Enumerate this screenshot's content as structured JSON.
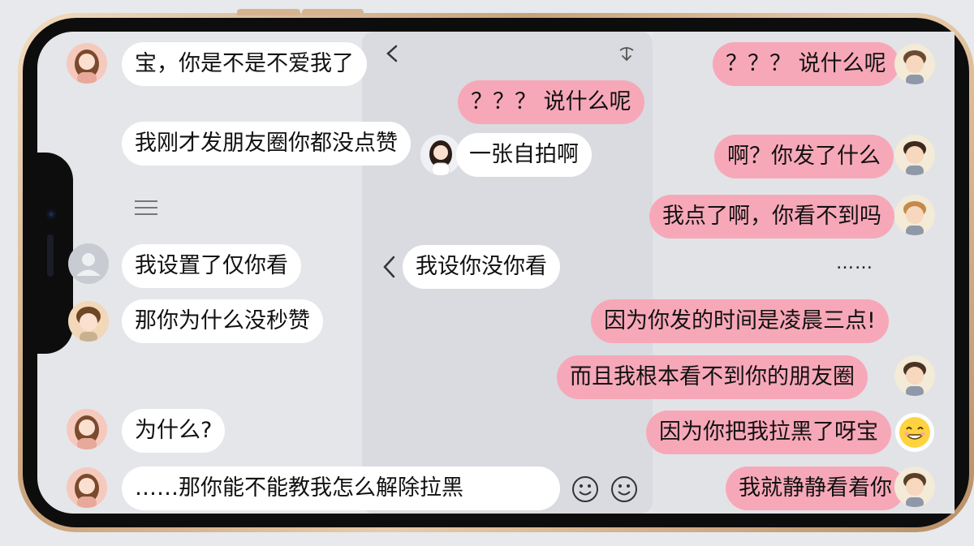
{
  "chat": {
    "left_messages": [
      {
        "text": "宝，你是不是不爱我了"
      },
      {
        "text": "我刚才发朋友圈你都没点赞"
      },
      {
        "text": "我设置了仅你看"
      },
      {
        "text": "那你为什么没秒赞"
      },
      {
        "text": "为什么?"
      },
      {
        "text": "……那你能不能教我怎么解除拉黑"
      }
    ],
    "middle_messages": [
      {
        "text": "？？？ 说什么呢"
      },
      {
        "text": "一张自拍啊"
      },
      {
        "text": "我设你没你看"
      }
    ],
    "right_messages": [
      {
        "text": "？？？ 说什么呢"
      },
      {
        "text": "啊？你发了什么"
      },
      {
        "text": "我点了啊，你看不到吗"
      },
      {
        "text": "因为你发的时间是凌晨三点!"
      },
      {
        "text": "而且我根本看不到你的朋友圈"
      },
      {
        "text": "因为你把我拉黑了呀宝"
      },
      {
        "text": "我就静静看着你"
      }
    ],
    "ellipsis": "……"
  },
  "colors": {
    "pink_bubble": "#f7a8b8",
    "white_bubble": "#ffffff",
    "screen_bg": "#e4e6ea"
  },
  "icons": [
    "back-chevron-icon",
    "swipe-down-icon",
    "menu-icon",
    "user-placeholder-icon",
    "smiley-icon",
    "smiley-emoji-icon"
  ]
}
